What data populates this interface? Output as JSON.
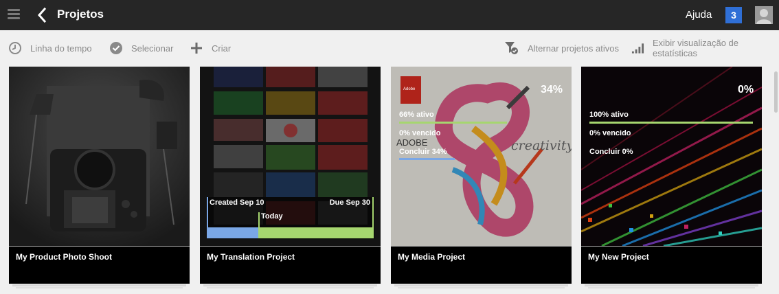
{
  "header": {
    "title": "Projetos",
    "help_label": "Ajuda",
    "notification_count": "3"
  },
  "toolbar": {
    "timeline_label": "Linha do tempo",
    "select_label": "Selecionar",
    "create_label": "Criar",
    "toggle_active_label": "Alternar projetos ativos",
    "stats_view_label": "Exibir visualização de estatísticas"
  },
  "cards": [
    {
      "name": "My Product Photo Shoot"
    },
    {
      "name": "My Translation Project",
      "created_label": "Created Sep 10",
      "due_label": "Due Sep 30",
      "today_label": "Today",
      "elapsed_fraction": 0.29
    },
    {
      "name": "My Media Project",
      "percent": "34%",
      "active_label": "66% ativo",
      "overdue_label": "0% vencido",
      "complete_label": "Concluir 34%",
      "adobe_label": "Adobe",
      "creativity_text": "creativity",
      "adobe_word": "ADOBE"
    },
    {
      "name": "My New Project",
      "percent": "0%",
      "active_label": "100% ativo",
      "overdue_label": "0% vencido",
      "complete_label": "Concluir 0%"
    }
  ],
  "colors": {
    "header_bg": "#262626",
    "active_bar": "#a6d66f",
    "complete_bar": "#7aa7e6",
    "badge": "#2f6fd6"
  }
}
